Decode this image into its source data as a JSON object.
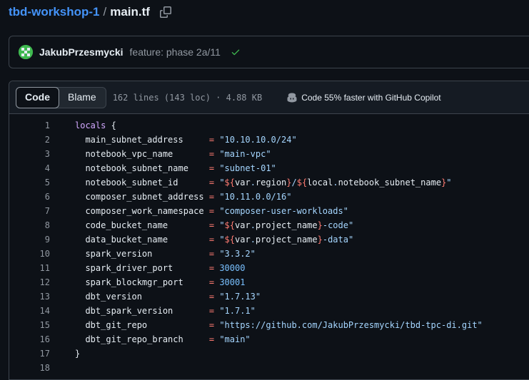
{
  "breadcrumb": {
    "repo": "tbd-workshop-1",
    "separator": "/",
    "file": "main.tf"
  },
  "commit": {
    "author": "JakubPrzesmycki",
    "message": "feature: phase 2a/11"
  },
  "file_header": {
    "tabs": [
      "Code",
      "Blame"
    ],
    "active_tab": "Code",
    "meta": "162 lines (143 loc) · 4.88 KB",
    "copilot": "Code 55% faster with GitHub Copilot"
  },
  "code_lines": [
    {
      "num": "1",
      "tokens": [
        [
          "k",
          "locals"
        ],
        [
          "p",
          " {"
        ]
      ]
    },
    {
      "num": "2",
      "tokens": [
        [
          "p",
          "  main_subnet_address     "
        ],
        [
          "op",
          "="
        ],
        [
          "p",
          " "
        ],
        [
          "s",
          "\"10.10.10.0/24\""
        ]
      ]
    },
    {
      "num": "3",
      "tokens": [
        [
          "p",
          "  notebook_vpc_name       "
        ],
        [
          "op",
          "="
        ],
        [
          "p",
          " "
        ],
        [
          "s",
          "\"main-vpc\""
        ]
      ]
    },
    {
      "num": "4",
      "tokens": [
        [
          "p",
          "  notebook_subnet_name    "
        ],
        [
          "op",
          "="
        ],
        [
          "p",
          " "
        ],
        [
          "s",
          "\"subnet-01\""
        ]
      ]
    },
    {
      "num": "5",
      "tokens": [
        [
          "p",
          "  notebook_subnet_id      "
        ],
        [
          "op",
          "="
        ],
        [
          "p",
          " "
        ],
        [
          "s",
          "\""
        ],
        [
          "op",
          "${"
        ],
        [
          "p",
          "var"
        ],
        [
          "s",
          "."
        ],
        [
          "p",
          "region"
        ],
        [
          "op",
          "}"
        ],
        [
          "s",
          "/"
        ],
        [
          "op",
          "${"
        ],
        [
          "p",
          "local"
        ],
        [
          "s",
          "."
        ],
        [
          "p",
          "notebook_subnet_name"
        ],
        [
          "op",
          "}"
        ],
        [
          "s",
          "\""
        ]
      ]
    },
    {
      "num": "6",
      "tokens": [
        [
          "p",
          "  composer_subnet_address "
        ],
        [
          "op",
          "="
        ],
        [
          "p",
          " "
        ],
        [
          "s",
          "\"10.11.0.0/16\""
        ]
      ]
    },
    {
      "num": "7",
      "tokens": [
        [
          "p",
          "  composer_work_namespace "
        ],
        [
          "op",
          "="
        ],
        [
          "p",
          " "
        ],
        [
          "s",
          "\"composer-user-workloads\""
        ]
      ]
    },
    {
      "num": "8",
      "tokens": [
        [
          "p",
          "  code_bucket_name        "
        ],
        [
          "op",
          "="
        ],
        [
          "p",
          " "
        ],
        [
          "s",
          "\""
        ],
        [
          "op",
          "${"
        ],
        [
          "p",
          "var"
        ],
        [
          "s",
          "."
        ],
        [
          "p",
          "project_name"
        ],
        [
          "op",
          "}"
        ],
        [
          "s",
          "-code\""
        ]
      ]
    },
    {
      "num": "9",
      "tokens": [
        [
          "p",
          "  data_bucket_name        "
        ],
        [
          "op",
          "="
        ],
        [
          "p",
          " "
        ],
        [
          "s",
          "\""
        ],
        [
          "op",
          "${"
        ],
        [
          "p",
          "var"
        ],
        [
          "s",
          "."
        ],
        [
          "p",
          "project_name"
        ],
        [
          "op",
          "}"
        ],
        [
          "s",
          "-data\""
        ]
      ]
    },
    {
      "num": "10",
      "tokens": [
        [
          "p",
          "  spark_version           "
        ],
        [
          "op",
          "="
        ],
        [
          "p",
          " "
        ],
        [
          "s",
          "\"3.3.2\""
        ]
      ]
    },
    {
      "num": "11",
      "tokens": [
        [
          "p",
          "  spark_driver_port       "
        ],
        [
          "op",
          "="
        ],
        [
          "p",
          " "
        ],
        [
          "n",
          "30000"
        ]
      ]
    },
    {
      "num": "12",
      "tokens": [
        [
          "p",
          "  spark_blockmgr_port     "
        ],
        [
          "op",
          "="
        ],
        [
          "p",
          " "
        ],
        [
          "n",
          "30001"
        ]
      ]
    },
    {
      "num": "13",
      "tokens": [
        [
          "p",
          "  dbt_version             "
        ],
        [
          "op",
          "="
        ],
        [
          "p",
          " "
        ],
        [
          "s",
          "\"1.7.13\""
        ]
      ]
    },
    {
      "num": "14",
      "tokens": [
        [
          "p",
          "  dbt_spark_version       "
        ],
        [
          "op",
          "="
        ],
        [
          "p",
          " "
        ],
        [
          "s",
          "\"1.7.1\""
        ]
      ]
    },
    {
      "num": "15",
      "tokens": [
        [
          "p",
          "  dbt_git_repo            "
        ],
        [
          "op",
          "="
        ],
        [
          "p",
          " "
        ],
        [
          "s",
          "\"https://github.com/JakubPrzesmycki/tbd-tpc-di.git\""
        ]
      ]
    },
    {
      "num": "16",
      "tokens": [
        [
          "p",
          "  dbt_git_repo_branch     "
        ],
        [
          "op",
          "="
        ],
        [
          "p",
          " "
        ],
        [
          "s",
          "\"main\""
        ]
      ]
    },
    {
      "num": "17",
      "tokens": [
        [
          "p",
          "}"
        ]
      ]
    },
    {
      "num": "18",
      "tokens": []
    }
  ]
}
